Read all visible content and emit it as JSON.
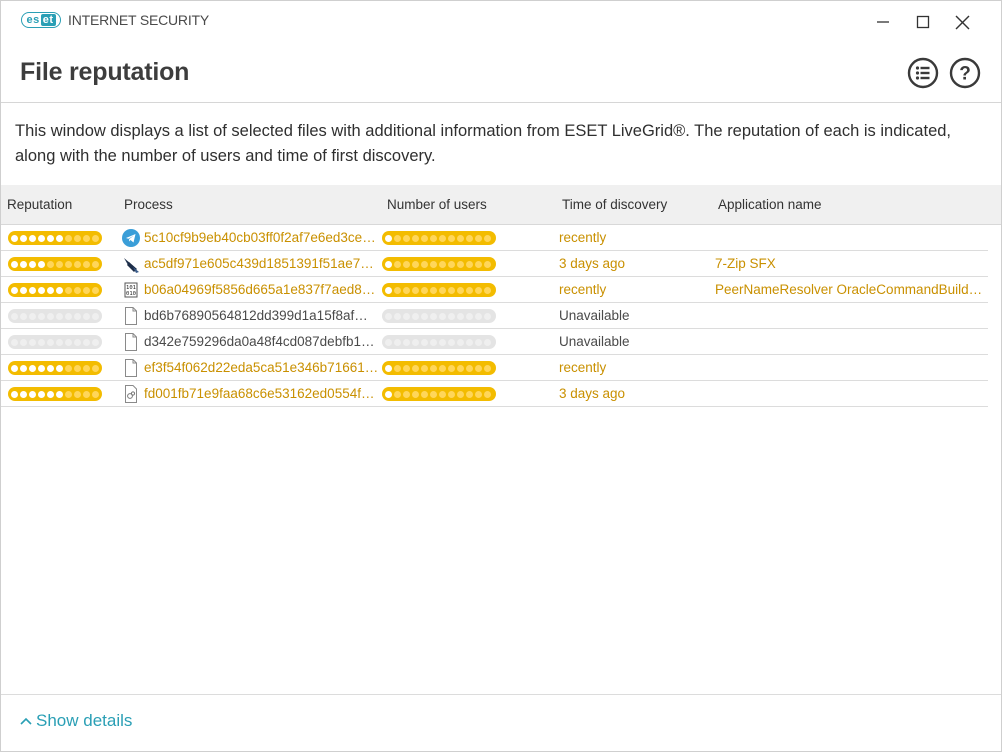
{
  "window": {
    "brand_logo": "eset",
    "product_name": "INTERNET SECURITY",
    "minimize_icon": "minimize-icon",
    "maximize_icon": "maximize-icon",
    "close_icon": "close-icon"
  },
  "header": {
    "title": "File reputation",
    "list_icon": "list-view-icon",
    "help_icon": "help-icon"
  },
  "description": "This window displays a list of selected files with additional information from ESET LiveGrid®. The reputation of each is indicated, along with the number of users and time of first discovery.",
  "table": {
    "columns": [
      "Reputation",
      "Process",
      "Number of users",
      "Time of discovery",
      "Application name"
    ],
    "rows": [
      {
        "reputation": 6,
        "icon": "telegram-icon",
        "process": "5c10cf9b9eb40cb03ff0f2af7e6ed3ce…",
        "users": 1,
        "time": "recently",
        "app": "",
        "status": "warn"
      },
      {
        "reputation": 4,
        "icon": "installer-icon",
        "process": "ac5df971e605c439d1851391f51ae7…",
        "users": 1,
        "time": "3 days ago",
        "app": "7-Zip SFX",
        "status": "warn"
      },
      {
        "reputation": 6,
        "icon": "binary-icon",
        "process": "b06a04969f5856d665a1e837f7aed8…",
        "users": 1,
        "time": "recently",
        "app": "PeerNameResolver OracleCommandBuilder…",
        "status": "warn"
      },
      {
        "reputation": 0,
        "icon": "file-icon",
        "process": "bd6b76890564812dd399d1a15f8af…",
        "users": 0,
        "time": "Unavailable",
        "app": "",
        "status": "norm"
      },
      {
        "reputation": 0,
        "icon": "file-icon",
        "process": "d342e759296da0a48f4cd087debfb1…",
        "users": 0,
        "time": "Unavailable",
        "app": "",
        "status": "norm"
      },
      {
        "reputation": 6,
        "icon": "file-icon",
        "process": "ef3f54f062d22eda5ca51e346b71661…",
        "users": 1,
        "time": "recently",
        "app": "",
        "status": "warn"
      },
      {
        "reputation": 6,
        "icon": "dll-file-icon",
        "process": "fd001fb71e9faa68c6e53162ed0554f…",
        "users": 1,
        "time": "3 days ago",
        "app": "",
        "status": "warn"
      }
    ]
  },
  "footer": {
    "show_details_label": "Show details",
    "chevron_icon": "chevron-up-icon"
  },
  "colors": {
    "accent": "#2a9fb5",
    "warning_bar": "#f3bc00",
    "warning_text": "#c99000",
    "inactive_bar": "#e4e4e4"
  }
}
